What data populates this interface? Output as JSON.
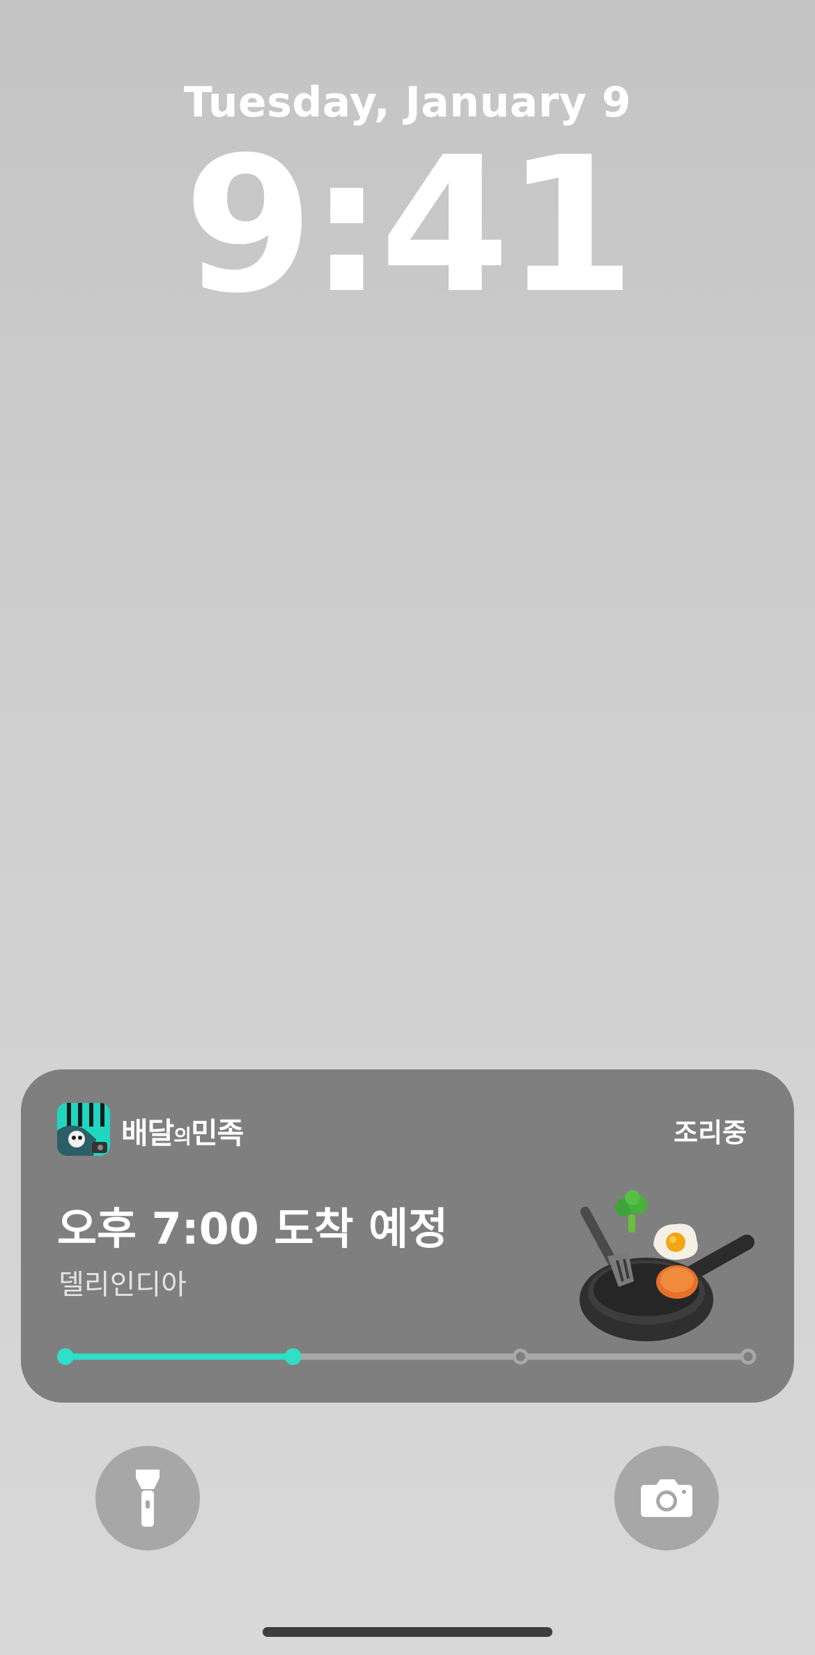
{
  "lockscreen": {
    "date": "Tuesday, January 9",
    "time": "9:41"
  },
  "live_activity": {
    "app_name_parts": [
      "배달",
      "의",
      "민족"
    ],
    "status": "조리중",
    "eta": "오후 7:00 도착 예정",
    "store": "델리인디아",
    "progress": {
      "total_steps": 4,
      "current_step": 2,
      "fraction": 0.333
    },
    "colors": {
      "accent": "#2fdfc7",
      "track": "#a8a8a8",
      "card": "#7f7f7f"
    },
    "icons": {
      "app": "baemin-app-icon",
      "illustration": "frying-pan-food-illustration"
    }
  },
  "quick_actions": {
    "left": "flashlight-icon",
    "right": "camera-icon"
  }
}
